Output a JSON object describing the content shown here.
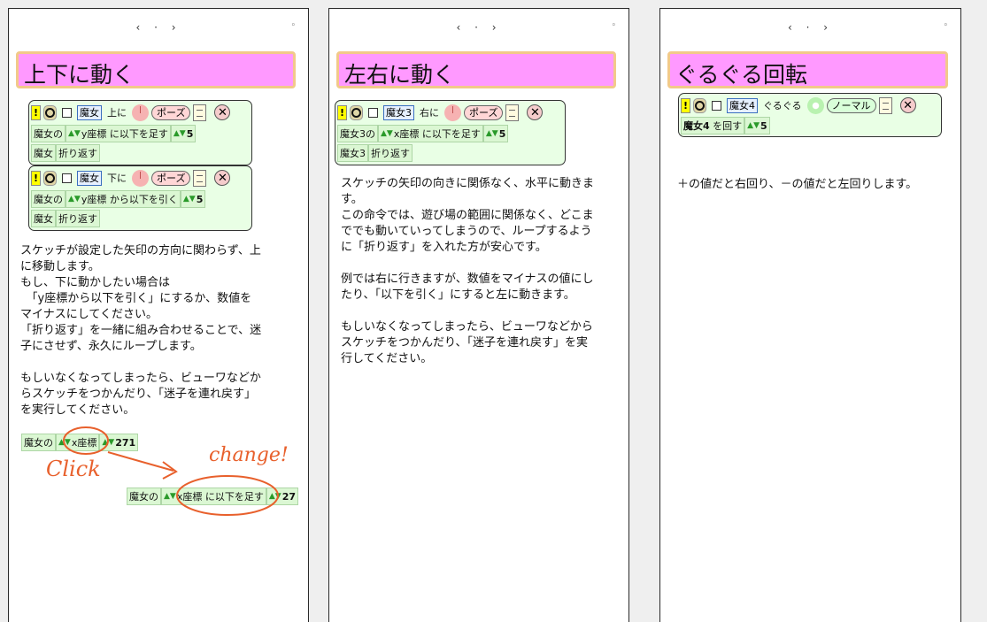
{
  "nav": {
    "prev": "‹",
    "dot": "·",
    "next": "›",
    "corner": "◦"
  },
  "pages": [
    {
      "title": "上下に動く",
      "scripts": [
        {
          "header": {
            "bang": "!",
            "object": "魔女",
            "verb": "上に",
            "pose": "ポーズ",
            "close": "✕"
          },
          "body": {
            "obj_of": "魔女の",
            "arrows": "▲▼",
            "command": "y座標 に以下を足す",
            "value": "5"
          },
          "loop": {
            "obj": "魔女",
            "action": "折り返す"
          }
        },
        {
          "header": {
            "bang": "!",
            "object": "魔女",
            "verb": "下に",
            "pose": "ポーズ",
            "close": "✕"
          },
          "body": {
            "obj_of": "魔女の",
            "arrows": "▲▼",
            "command": "y座標 から以下を引く",
            "value": "5"
          },
          "loop": {
            "obj": "魔女",
            "action": "折り返す"
          }
        }
      ],
      "text": [
        "スケッチが設定した矢印の方向に関わらず、上",
        "に移動します。",
        "もし、下に動かしたい場合は",
        "　「y座標から以下を引く」にするか、数値を",
        "マイナスにしてください。",
        "「折り返す」を一緒に組み合わせることで、迷",
        "子にさせず、永久にループします。",
        "",
        "もしいなくなってしまったら、ビューワなどか",
        "らスケッチをつかんだり、「迷子を連れ戻す」",
        "を実行してください。"
      ],
      "example1": {
        "obj_of": "魔女の",
        "arrows": "▲▼",
        "field": "x座標",
        "value": "271"
      },
      "example2": {
        "obj_of": "魔女の",
        "arrows": "▲▼",
        "command": "x座標 に以下を足す",
        "value": "27"
      },
      "annotations": {
        "click": "Click",
        "change": "change!"
      }
    },
    {
      "title": "左右に動く",
      "script": {
        "header": {
          "bang": "!",
          "object": "魔女3",
          "verb": "右に",
          "pose": "ポーズ",
          "close": "✕"
        },
        "body": {
          "obj_of": "魔女3の",
          "arrows": "▲▼",
          "command": "x座標 に以下を足す",
          "value": "5"
        },
        "loop": {
          "obj": "魔女3",
          "action": "折り返す"
        }
      },
      "text": [
        "スケッチの矢印の向きに関係なく、水平に動きま",
        "す。",
        "この命令では、遊び場の範囲に関係なく、どこま",
        "ででも動いていってしまうので、ループするよう",
        "に「折り返す」を入れた方が安心です。",
        "",
        "例では右に行きますが、数値をマイナスの値にし",
        "たり、「以下を引く」にすると左に動きます。",
        "",
        "もしいなくなってしまったら、ビューワなどから",
        "スケッチをつかんだり、「迷子を連れ戻す」を実",
        "行してください。"
      ]
    },
    {
      "title": "ぐるぐる回転",
      "script": {
        "header": {
          "bang": "!",
          "object": "魔女4",
          "verb": "ぐるぐる",
          "mode": "ノーマル",
          "close": "✕"
        },
        "body": {
          "obj": "魔女4",
          "command": "を回す",
          "arrows": "▲▼",
          "value": "5"
        }
      },
      "text": [
        "＋の値だと右回り、－の値だと左回りします。"
      ]
    }
  ]
}
